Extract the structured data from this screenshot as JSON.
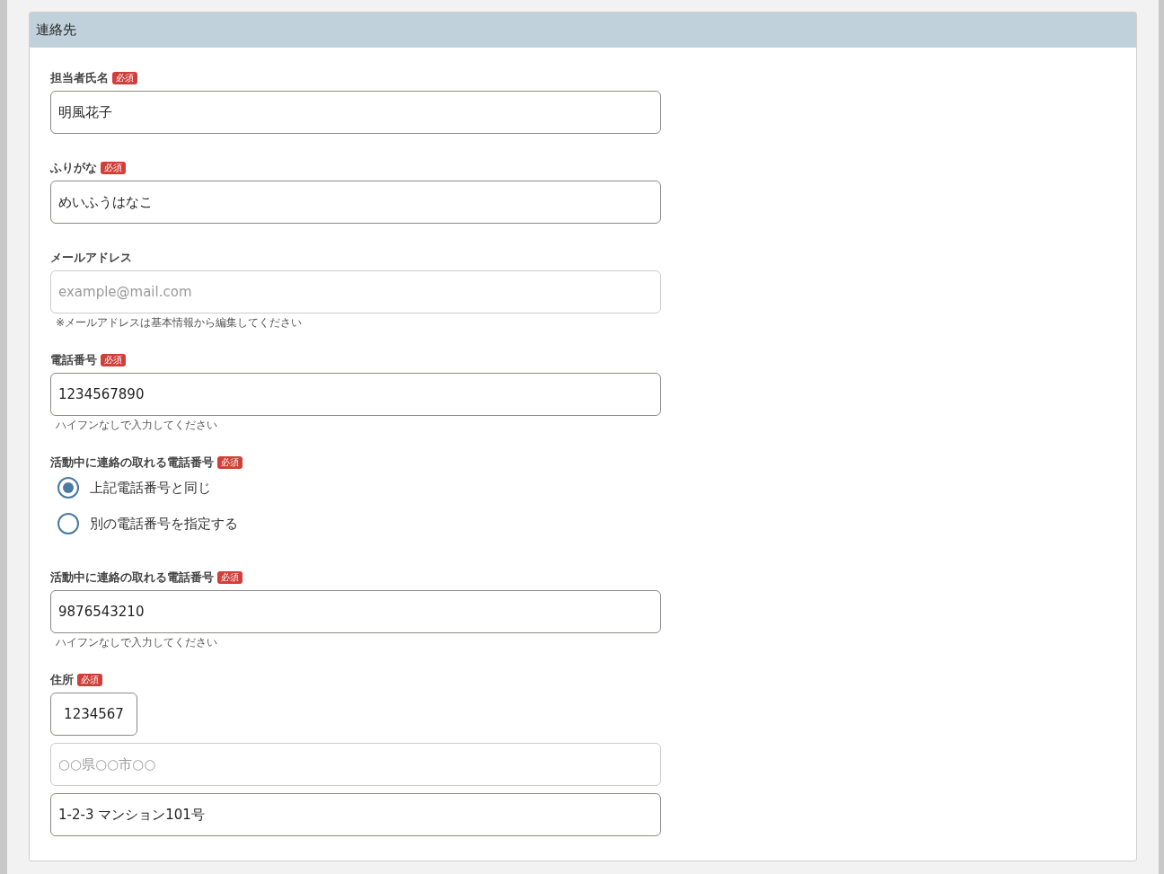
{
  "section": {
    "title": "連絡先"
  },
  "fields": [
    {
      "kind": "input",
      "label": "担当者氏名",
      "required": true,
      "required_label": "必須",
      "value": "明風花子",
      "disabled": false
    },
    {
      "kind": "input",
      "label": "ふりがな",
      "required": true,
      "required_label": "必須",
      "value": "めいふうはなこ",
      "disabled": false
    },
    {
      "kind": "input",
      "label": "メールアドレス",
      "required": false,
      "placeholder": "example@mail.com",
      "disabled": true,
      "hint": "※メールアドレスは基本情報から編集してください"
    },
    {
      "kind": "input",
      "label": "電話番号",
      "required": true,
      "required_label": "必須",
      "value": "1234567890",
      "disabled": false,
      "hint": "ハイフンなしで入力してください"
    },
    {
      "kind": "radio_group",
      "label": "活動中に連絡の取れる電話番号",
      "required": true,
      "required_label": "必須",
      "options": [
        {
          "label": "上記電話番号と同じ",
          "selected": true
        },
        {
          "label": "別の電話番号を指定する",
          "selected": false
        }
      ]
    },
    {
      "kind": "input",
      "label": "活動中に連絡の取れる電話番号",
      "required": true,
      "required_label": "必須",
      "value": "9876543210",
      "disabled": false,
      "hint": "ハイフンなしで入力してください"
    },
    {
      "kind": "address",
      "label": "住所",
      "required": true,
      "required_label": "必須",
      "postal_code": "1234567",
      "region_placeholder": "○○県○○市○○",
      "street": "1-2-3 マンション101号"
    }
  ]
}
